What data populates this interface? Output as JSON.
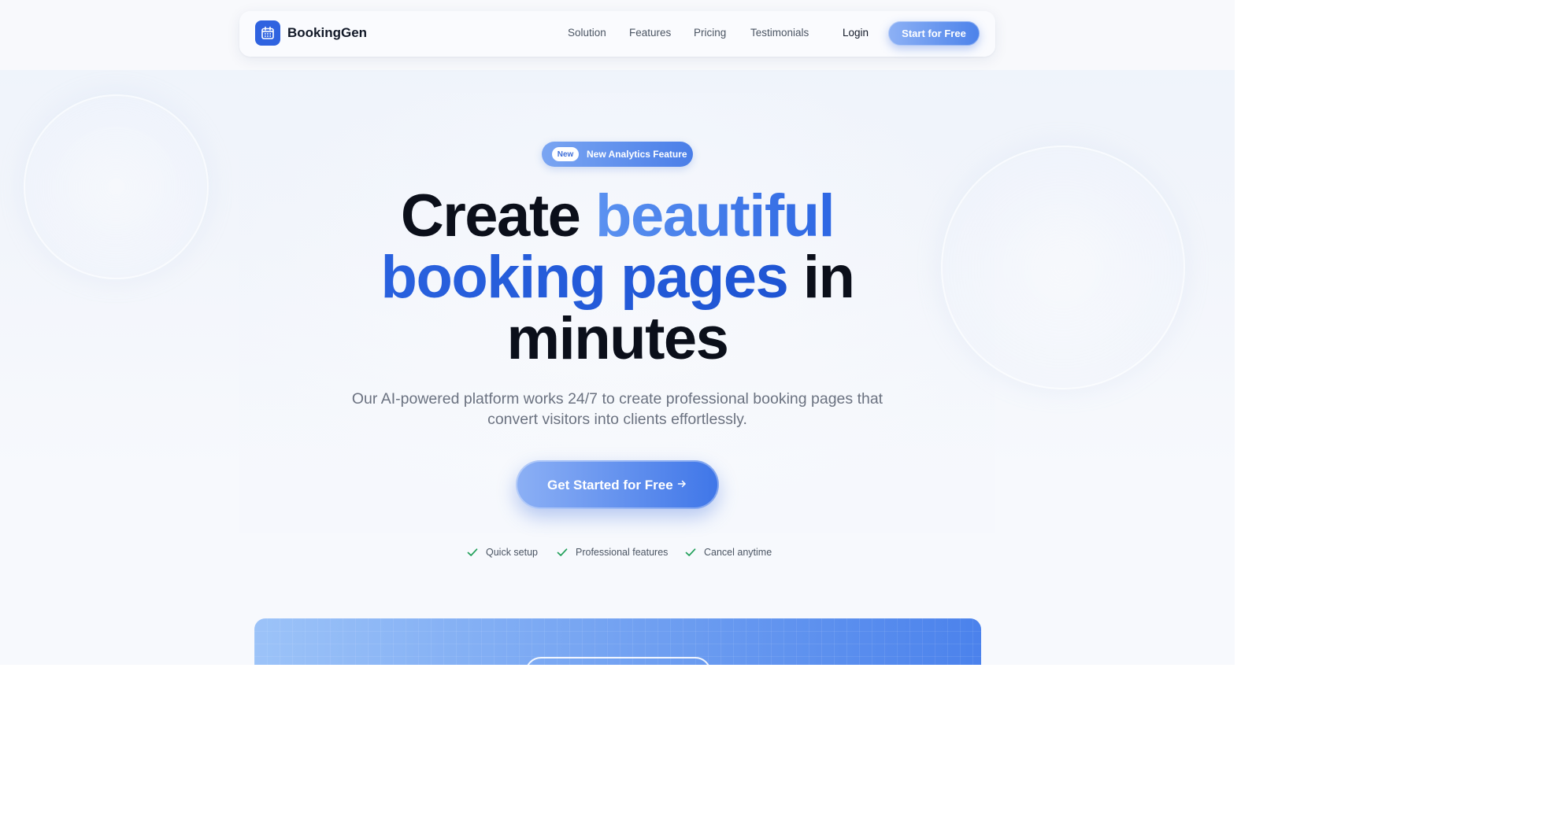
{
  "brand": {
    "name": "BookingGen",
    "icon": "calendar-icon"
  },
  "nav": {
    "links": [
      "Solution",
      "Features",
      "Pricing",
      "Testimonials"
    ],
    "login": "Login",
    "cta": "Start for Free"
  },
  "hero": {
    "badge": {
      "tag": "New",
      "text": "New Analytics Feature"
    },
    "headline": {
      "part1": "Create ",
      "highlight1": "beautiful",
      "highlight2": "booking pages",
      "part2": " in",
      "part3": "minutes"
    },
    "subtitle": "Our AI-powered platform works 24/7 to create professional booking pages that convert visitors into clients effortlessly.",
    "cta": {
      "label": "Get Started for Free",
      "icon": "arrow-right-icon"
    },
    "checks": [
      "Quick setup",
      "Professional features",
      "Cancel anytime"
    ]
  },
  "colors": {
    "primary": "#2f63e0",
    "accent_light": "#8db1f5",
    "check_green": "#22a05a",
    "text_dark": "#0b0f1a",
    "text_muted": "#6b7280"
  }
}
